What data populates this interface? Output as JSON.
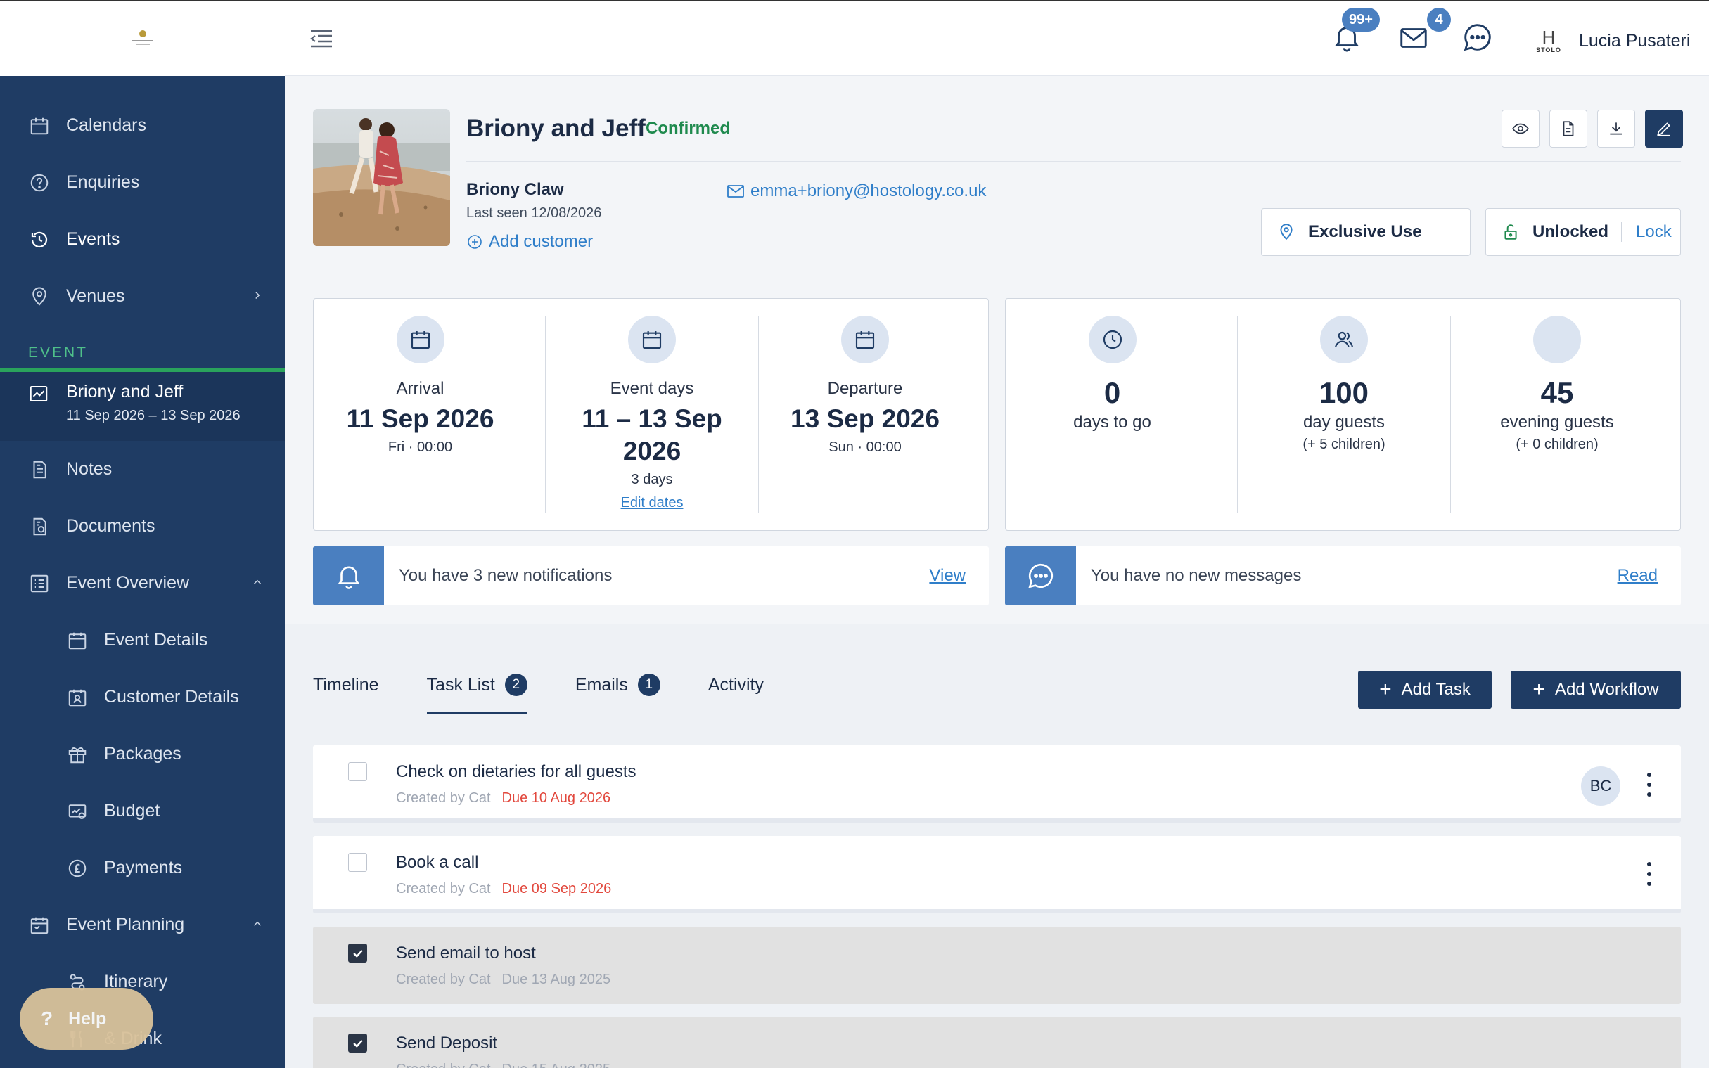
{
  "sidebar": {
    "nav_top": [
      {
        "label": "Calendars",
        "icon": "calendar-icon"
      },
      {
        "label": "Enquiries",
        "icon": "question-icon"
      },
      {
        "label": "Events",
        "icon": "clock-history-icon"
      },
      {
        "label": "Venues",
        "icon": "location-pin-icon"
      }
    ],
    "section_label": "EVENT",
    "current_event": {
      "title": "Briony and Jeff",
      "dates": "11 Sep 2026 – 13 Sep 2026"
    },
    "nav_event": [
      {
        "label": "Notes"
      },
      {
        "label": "Documents"
      },
      {
        "label": "Event Overview"
      },
      {
        "label": "Event Details"
      },
      {
        "label": "Customer Details"
      },
      {
        "label": "Packages"
      },
      {
        "label": "Budget"
      },
      {
        "label": "Payments"
      },
      {
        "label": "Event Planning"
      },
      {
        "label": "Itinerary"
      },
      {
        "label": "& Drink"
      }
    ],
    "help_label": "Help"
  },
  "topbar": {
    "notifications_badge": "99+",
    "mail_badge": "4",
    "brand_letter": "H",
    "brand_word": "STOLO",
    "user_name": "Lucia Pusateri"
  },
  "event": {
    "title": "Briony and Jeff",
    "status": "Confirmed",
    "customer_name": "Briony Claw",
    "last_seen": "Last seen 12/08/2026",
    "add_customer": "Add customer",
    "email": "emma+briony@hostology.co.uk",
    "exclusive_use": "Exclusive Use",
    "lock_state": "Unlocked",
    "lock_link": "Lock"
  },
  "dates_card": {
    "arrival": {
      "label": "Arrival",
      "value": "11 Sep 2026",
      "sub": "Fri · 00:00"
    },
    "event_days": {
      "label": "Event days",
      "value_line1": "11 – 13 Sep",
      "value_line2": "2026",
      "sub": "3 days",
      "link": "Edit dates"
    },
    "departure": {
      "label": "Departure",
      "value": "13 Sep 2026",
      "sub": "Sun · 00:00"
    }
  },
  "counts_card": {
    "days": {
      "value": "0",
      "label": "days to go"
    },
    "day_guests": {
      "value": "100",
      "label": "day guests",
      "sub": "(+ 5 children)"
    },
    "evening_guests": {
      "value": "45",
      "label": "evening guests",
      "sub": "(+ 0 children)"
    }
  },
  "notices": {
    "notifications": {
      "text": "You have 3 new notifications",
      "link": "View"
    },
    "messages": {
      "text": "You have no new messages",
      "link": "Read"
    }
  },
  "tabs": [
    {
      "label": "Timeline",
      "count": ""
    },
    {
      "label": "Task List",
      "count": "2"
    },
    {
      "label": "Emails",
      "count": "1"
    },
    {
      "label": "Activity",
      "count": ""
    }
  ],
  "buttons": {
    "add_task": "Add Task",
    "add_workflow": "Add Workflow"
  },
  "tasks": [
    {
      "name": "Check on dietaries for all guests",
      "created": "Created by Cat",
      "due": "Due 10 Aug 2026",
      "assignee": "BC",
      "done": false
    },
    {
      "name": "Book a call",
      "created": "Created by Cat",
      "due": "Due 09 Sep 2026",
      "assignee": "",
      "done": false
    },
    {
      "name": "Send email to host",
      "created": "Created by Cat",
      "due": "Due 13 Aug 2025",
      "assignee": "",
      "done": true
    },
    {
      "name": "Send Deposit",
      "created": "Created by Cat",
      "due": "Due 15 Aug 2025",
      "assignee": "",
      "done": true
    }
  ],
  "colors": {
    "sidebar_bg": "#1f3c64",
    "accent_blue": "#4a7fc0",
    "link_blue": "#2f7ec9",
    "confirmed_green": "#1f8a4e",
    "overdue_red": "#e2483d"
  }
}
